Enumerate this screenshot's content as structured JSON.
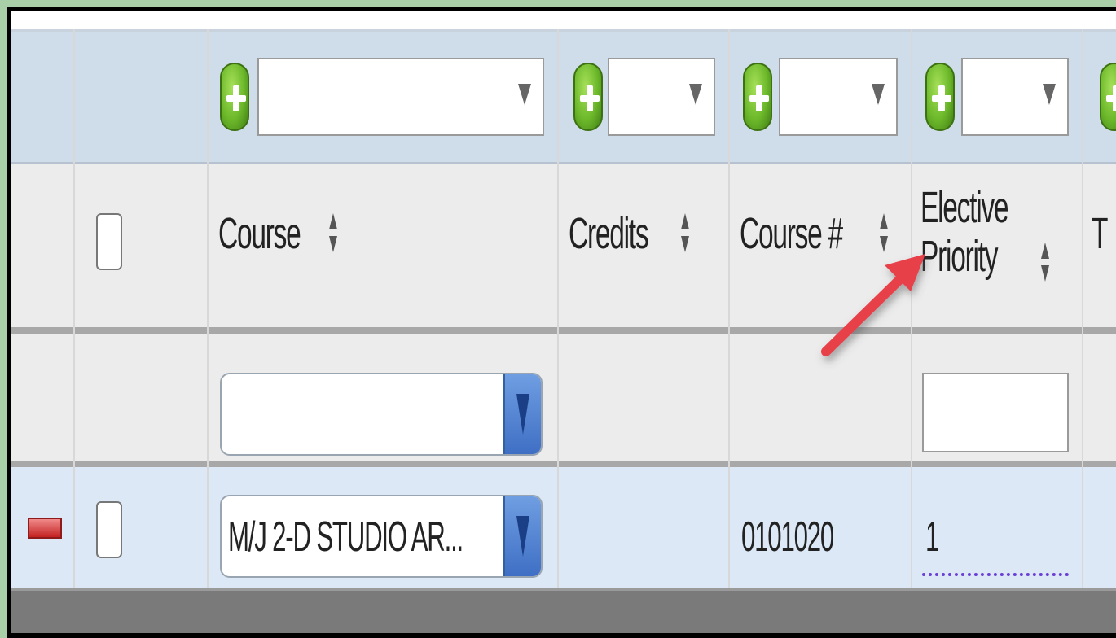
{
  "table": {
    "headers": {
      "course": "Course",
      "credits": "Credits",
      "course_number": "Course #",
      "elective_line1": "Elective",
      "elective_line2": "Priority",
      "truncated": "T"
    },
    "filter": {
      "course_value": "",
      "elective_priority_value": ""
    },
    "rows": [
      {
        "course": "M/J 2-D STUDIO AR...",
        "credits": "",
        "course_number": "0101020",
        "elective_priority": "1"
      }
    ]
  },
  "icons": {
    "add": "plus-circle-icon",
    "remove": "remove-row-icon",
    "dropdown": "triangle-down-icon",
    "sort": "sort-arrows-icon",
    "annotation": "red-arrow-icon"
  },
  "colors": {
    "accent_green": "#6cb82a",
    "select_blue": "#3f6fc4",
    "annotation_red": "#e8404a",
    "row_highlight": "#dde8f7"
  }
}
